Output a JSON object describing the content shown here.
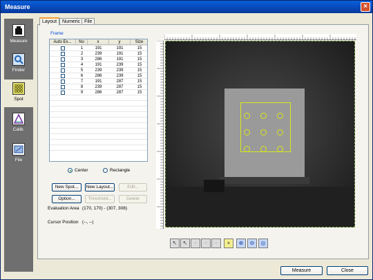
{
  "window": {
    "title": "Measure"
  },
  "sidebar": {
    "items": [
      {
        "label": "Measure",
        "icon": "measure-icon"
      },
      {
        "label": "Finder",
        "icon": "finder-icon"
      },
      {
        "label": "Spot",
        "icon": "spot-icon",
        "active": true
      },
      {
        "label": "Calib.",
        "icon": "calibration-icon"
      },
      {
        "label": "File",
        "icon": "file-icon"
      }
    ]
  },
  "tabs": [
    {
      "label": "Layout",
      "active": true
    },
    {
      "label": "Numeric"
    },
    {
      "label": "File"
    }
  ],
  "frame": {
    "label": "Frame",
    "columns": [
      "Auto Ex...",
      "No",
      "x",
      "y",
      "Size"
    ],
    "rows": [
      {
        "no": "1",
        "x": "191",
        "y": "191",
        "size": "15"
      },
      {
        "no": "2",
        "x": "239",
        "y": "191",
        "size": "15"
      },
      {
        "no": "3",
        "x": "286",
        "y": "191",
        "size": "15"
      },
      {
        "no": "4",
        "x": "191",
        "y": "239",
        "size": "15"
      },
      {
        "no": "5",
        "x": "239",
        "y": "239",
        "size": "15"
      },
      {
        "no": "6",
        "x": "286",
        "y": "239",
        "size": "15"
      },
      {
        "no": "7",
        "x": "191",
        "y": "287",
        "size": "15"
      },
      {
        "no": "8",
        "x": "239",
        "y": "287",
        "size": "15"
      },
      {
        "no": "9",
        "x": "286",
        "y": "287",
        "size": "15"
      }
    ]
  },
  "mode": {
    "center_label": "Center",
    "rectangle_label": "Rectangle",
    "selected": "Center"
  },
  "buttons": {
    "new_spot": "New Spot...",
    "new_layout": "New Layout...",
    "edit": "Edit...",
    "option": "Option...",
    "threshold": "Threshold...",
    "delete": "Delete"
  },
  "info": {
    "evaluation_area_label": "Evaluation Area",
    "evaluation_area_value": "(170, 170) - (307, 308)",
    "cursor_position_label": "Cursor Position",
    "cursor_position_value": "(--, --)"
  },
  "toolbar": {
    "tools": [
      "select-arrow-icon",
      "select-spot-icon",
      "move-icon",
      "resize-icon",
      "delete-spot-icon",
      "grid-icon",
      "zoom-in-icon",
      "zoom-out-icon",
      "zoom-fit-icon"
    ]
  },
  "footer": {
    "measure_label": "Measure",
    "close_label": "Close"
  },
  "colors": {
    "overlay": "#d8e81a",
    "title_bar": "#0a5fd8",
    "sidebar": "#6f6f6f"
  }
}
